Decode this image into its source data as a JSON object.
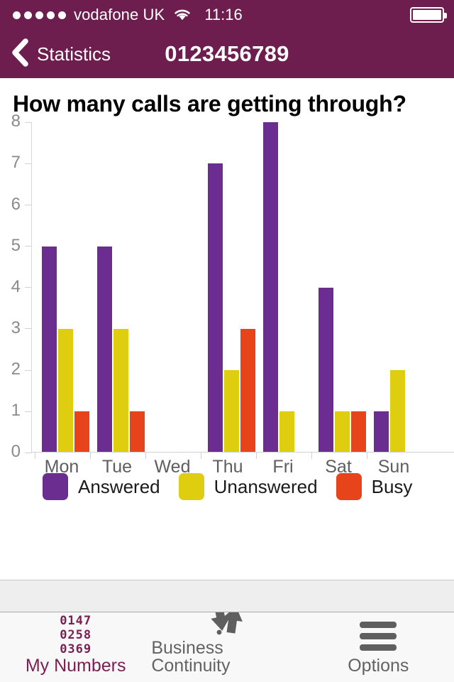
{
  "statusbar": {
    "signal_dots": 5,
    "carrier": "vodafone UK",
    "wifi_icon": "wifi-icon",
    "time": "11:16",
    "battery_icon": "battery-full-icon"
  },
  "navbar": {
    "back_icon": "chevron-left-icon",
    "back_label": "Statistics",
    "title": "0123456789",
    "background": "#6E1E4E"
  },
  "chart_data": {
    "type": "bar",
    "title": "How many calls are getting through?",
    "xlabel": "",
    "ylabel": "",
    "ylim": [
      0,
      8
    ],
    "yticks": [
      0,
      1,
      2,
      3,
      4,
      5,
      6,
      7,
      8
    ],
    "grid": false,
    "legend_position": "bottom",
    "categories": [
      "Mon",
      "Tue",
      "Wed",
      "Thu",
      "Fri",
      "Sat",
      "Sun"
    ],
    "series": [
      {
        "name": "Answered",
        "color": "#6B2D90",
        "values": [
          5,
          5,
          0,
          7,
          8,
          4,
          1
        ]
      },
      {
        "name": "Unanswered",
        "color": "#DFCE10",
        "values": [
          3,
          3,
          0,
          2,
          1,
          1,
          2
        ]
      },
      {
        "name": "Busy",
        "color": "#E8441C",
        "values": [
          1,
          1,
          0,
          3,
          0,
          1,
          0
        ]
      }
    ]
  },
  "tabbar": {
    "items": [
      {
        "label": "My Numbers",
        "icon": "number-grid-icon",
        "active": true,
        "icon_lines": [
          "0147",
          "0258",
          "0369"
        ]
      },
      {
        "label": "Business Continuity",
        "icon": "arrows-updown-icon",
        "active": false
      },
      {
        "label": "Options",
        "icon": "hamburger-menu-icon",
        "active": false
      }
    ],
    "active_color": "#7B1E52",
    "inactive_color": "#636363"
  }
}
